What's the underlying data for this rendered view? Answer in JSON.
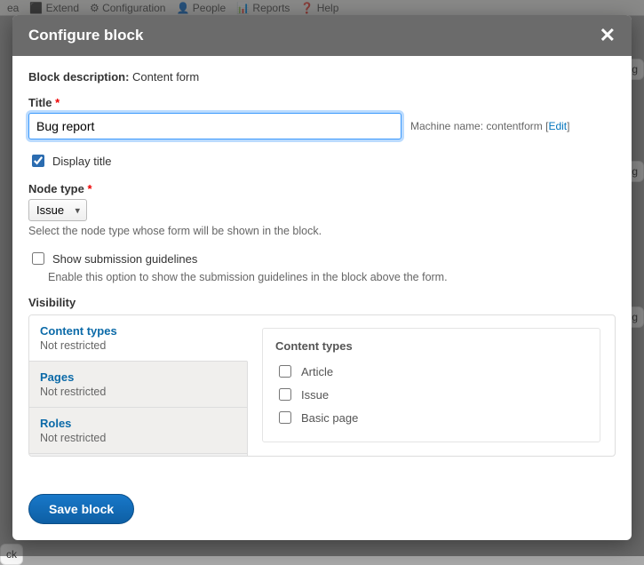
{
  "modal": {
    "title": "Configure block",
    "block_description_label": "Block description:",
    "block_description_value": "Content form",
    "title_label": "Title",
    "title_value": "Bug report",
    "machine_name_label": "Machine name:",
    "machine_name_value": "contentform",
    "machine_name_edit": "Edit",
    "display_title_label": "Display title",
    "node_type_label": "Node type",
    "node_type_value": "Issue",
    "node_type_help": "Select the node type whose form will be shown in the block.",
    "show_guidelines_label": "Show submission guidelines",
    "show_guidelines_help": "Enable this option to show the submission guidelines in the block above the form.",
    "visibility_label": "Visibility",
    "vis_tabs": [
      {
        "title": "Content types",
        "sub": "Not restricted"
      },
      {
        "title": "Pages",
        "sub": "Not restricted"
      },
      {
        "title": "Roles",
        "sub": "Not restricted"
      }
    ],
    "panel_title": "Content types",
    "panel_options": [
      "Article",
      "Issue",
      "Basic page"
    ],
    "save_label": "Save block"
  },
  "bg": {
    "fig_label": "fig",
    "ck_label": "ck"
  }
}
